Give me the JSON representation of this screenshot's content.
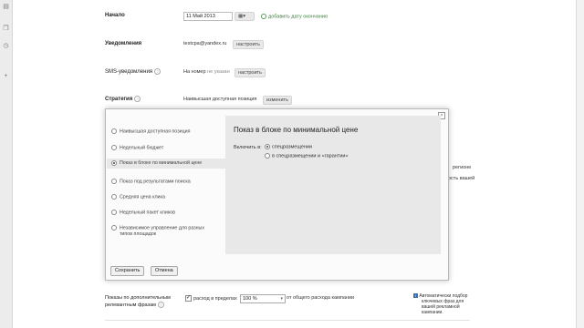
{
  "start": {
    "label": "Начало",
    "date": "11 Май 2013",
    "add_end": "добавить дату окончания"
  },
  "notifications": {
    "label": "Уведомления",
    "email": "testcpa@yandex.ru",
    "configure": "настроить"
  },
  "sms": {
    "label": "SMS-уведомления",
    "value_prefix": "На номер",
    "value_muted": "не указан",
    "configure": "настроить"
  },
  "strategy": {
    "label": "Стратегия",
    "value": "Наивысшая доступная позиция",
    "change": "изменить"
  },
  "dialog": {
    "strategies": [
      "Наивысшая доступная позиция",
      "Недельный бюджет",
      "Показ в блоке по минимальной цене",
      "Показ под результатами поиска",
      "Средняя цена клика",
      "Недельный пакет кликов",
      "Независимое управление для разных",
      "типов площадок"
    ],
    "panel_title": "Показ в блоке по минимальной цене",
    "include_label": "Включить в:",
    "options": [
      "спецразмещении",
      "в спецразмещении и «гарантии»"
    ],
    "save": "Сохранить",
    "cancel": "Отмена"
  },
  "right_fragments": [
    "регионе",
    "ость вашей"
  ],
  "extra_phrases": {
    "label_line1": "Показы по дополнительным",
    "label_line2": "релевантным фразам",
    "checkbox_label": "расход в пределах",
    "percent": "100 %",
    "suffix": "от общего расхода кампании",
    "info_lines": [
      "Автоматически подбор",
      "ключевых фраз для",
      "вашей рекламной",
      "кампании."
    ]
  }
}
